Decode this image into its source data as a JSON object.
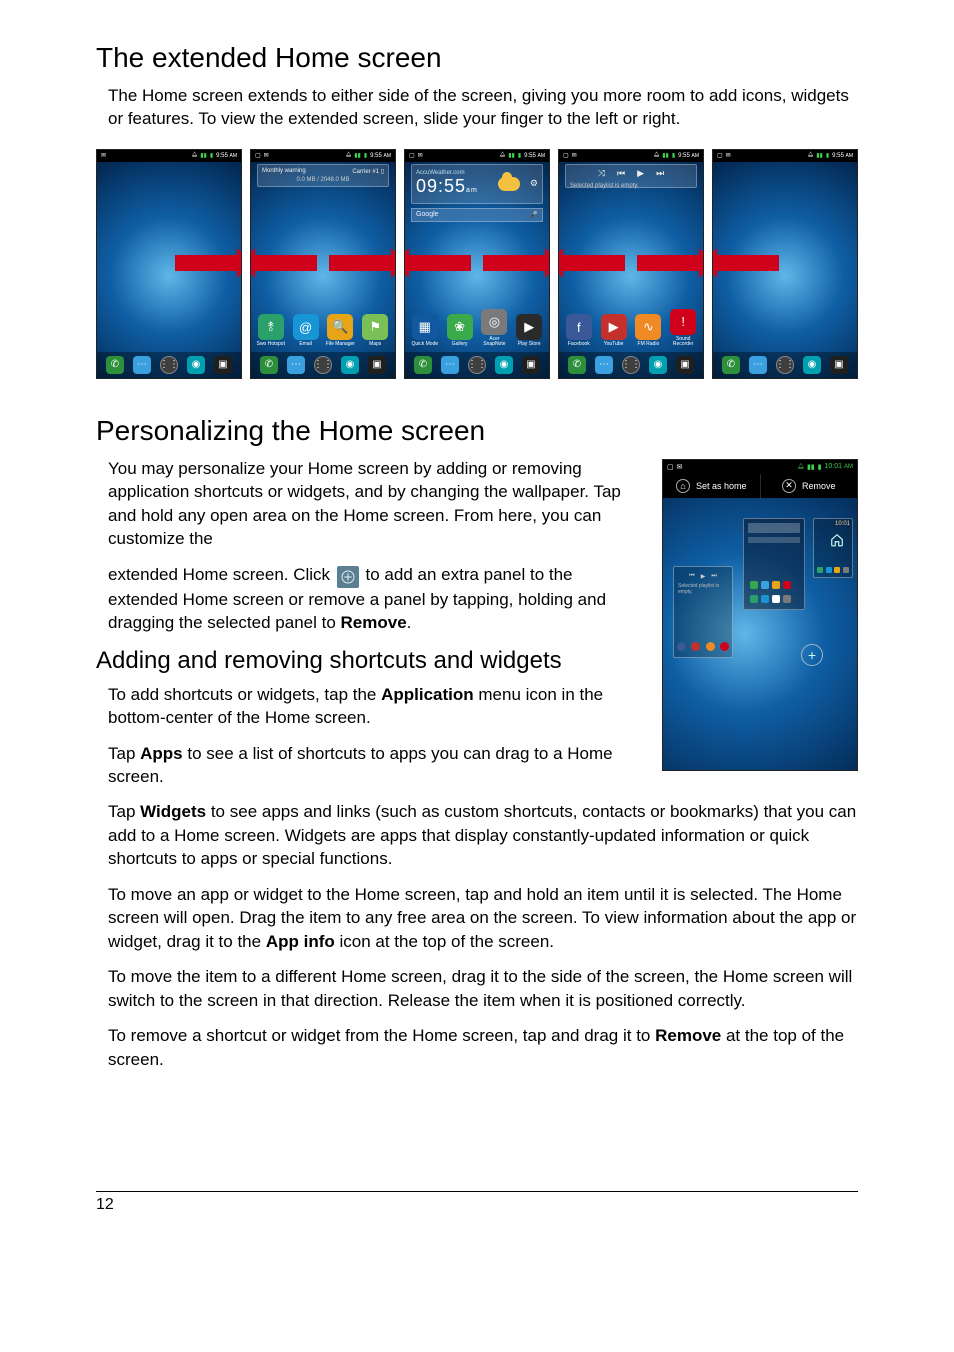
{
  "page_number": "12",
  "h_extended": "The extended Home screen",
  "p_extended": "The Home screen extends to either side of the screen, giving you more room to add icons, widgets or features. To view the extended screen, slide your finger to the left or right.",
  "shots": {
    "time": "9:55",
    "am": "AM",
    "warning_label": "Monthly warning",
    "carrier": "Carrier #1",
    "data_usage": "0.0 MB / 2048.0 MB",
    "accu": "AccuWeather.com",
    "clock": "09:55",
    "clock_suffix": "am",
    "search_label": "Google",
    "playlist_empty": "Selected playlist is empty.",
    "icons2": {
      "hotspot": "Swo Hotspot",
      "email": "Email",
      "files": "File Manager",
      "maps": "Maps"
    },
    "icons3": {
      "quick": "Quick Mode",
      "gallery": "Gallery",
      "snap": "Acer SnapNote",
      "play": "Play Store"
    },
    "icons4": {
      "fb": "Facebook",
      "yt": "YouTube",
      "fm": "FM Radio",
      "rec": "Sound Recorder"
    }
  },
  "h_personalize": "Personalizing the Home screen",
  "p_personalize_1": "You may personalize your Home screen by adding or removing application shortcuts or widgets, and by changing the wallpaper. Tap and hold any open area on the Home screen. From here, you can customize the",
  "p_personalize_2a": "extended Home screen. Click ",
  "p_personalize_2b": " to add an extra panel to the extended Home screen or remove a panel by tapping, holding and dragging the selected panel to ",
  "p_personalize_2c": ".",
  "remove_bold": "Remove",
  "sideshot": {
    "time": "10:01",
    "am": "AM",
    "set_home": "Set as home",
    "remove": "Remove",
    "mini_clock": "10:01",
    "playlist_empty": "Selected playlist is empty."
  },
  "h_adding": "Adding and removing shortcuts and widgets",
  "p_add_1a": "To add shortcuts or widgets, tap the ",
  "p_add_1b": " menu icon in the bottom-center of the Home screen.",
  "application_bold": "Application",
  "p_add_2a": "Tap ",
  "p_add_2b": " to see a list of shortcuts to apps you can drag to a Home screen.",
  "apps_bold": "Apps",
  "p_add_3a": "Tap ",
  "p_add_3b": " to see apps and links (such as custom shortcuts, contacts or bookmarks) that you can add to a Home screen. Widgets are apps that display constantly-updated information or quick shortcuts to apps or special functions.",
  "widgets_bold": "Widgets",
  "p_add_4a": "To move an app or widget to the Home screen, tap and hold an item until it is selected. The Home screen will open. Drag the item to any free area on the screen. To view information about the app or widget, drag it to the ",
  "p_add_4b": " icon at the top of the screen.",
  "appinfo_bold": "App info",
  "p_add_5": "To move the item to a different Home screen, drag it to the side of the screen, the Home screen will switch to the screen in that direction. Release the item when it is positioned correctly.",
  "p_add_6a": "To remove a shortcut or widget from the Home screen, tap and drag it to ",
  "p_add_6b": " at the top of the screen."
}
